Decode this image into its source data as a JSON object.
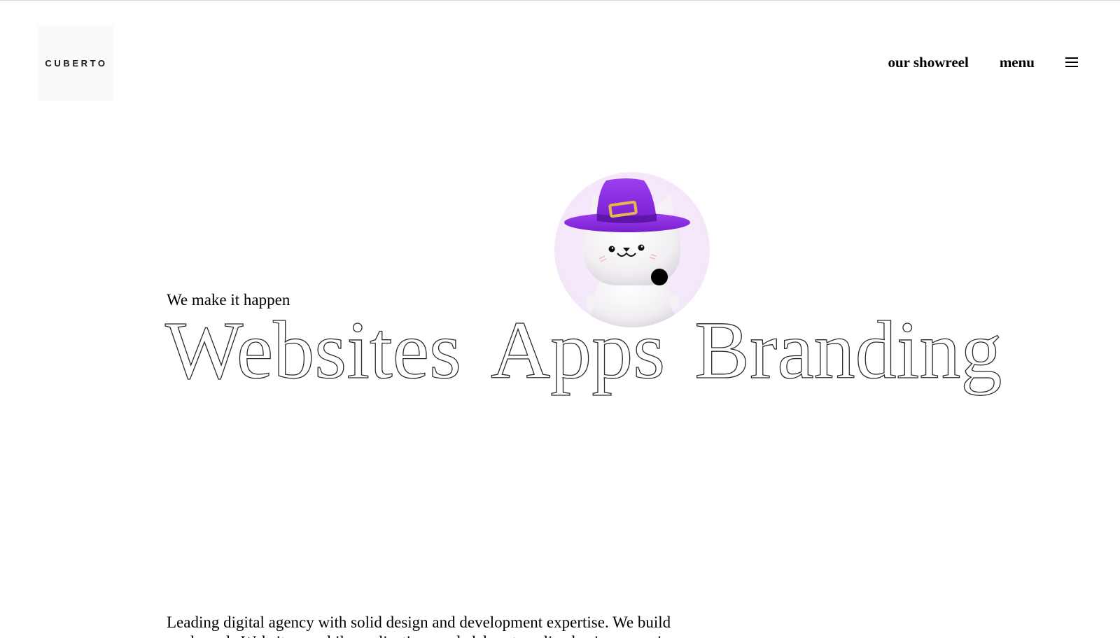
{
  "header": {
    "logo_text": "CUBERTO",
    "nav": {
      "showreel_label": "our showreel",
      "menu_label": "menu",
      "menu_icon": "hamburger-icon"
    }
  },
  "hero": {
    "eyebrow": "We make it happen",
    "headline_words": [
      "Websites",
      "Apps",
      "Branding"
    ],
    "mascot": {
      "icon": "cat-wizard-mascot",
      "hat_color": "#8a2be2",
      "bg_color": "#f5e9fb"
    }
  },
  "intro": {
    "text": "Leading digital agency with solid design and development expertise. We build readymade Websites, mobile applications and elaborate online business services."
  },
  "colors": {
    "text": "#000000",
    "accent_purple": "#8a2be2",
    "outline": "#2a2a2a"
  }
}
